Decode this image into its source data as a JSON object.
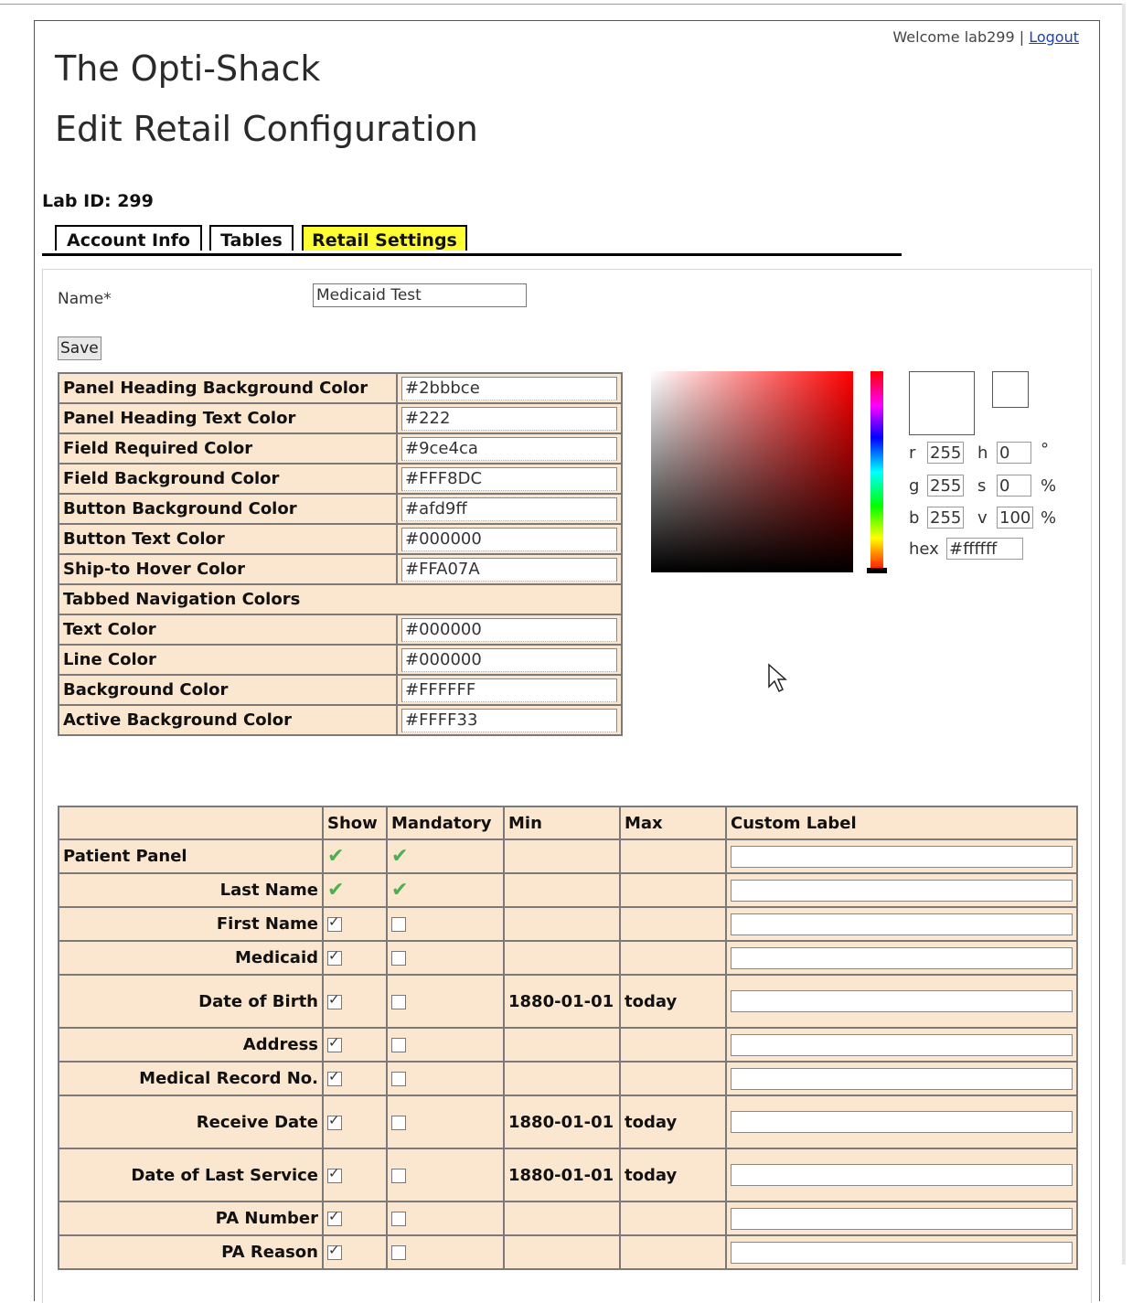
{
  "header": {
    "welcome_text": "Welcome lab299 |",
    "logout_label": "Logout",
    "app_title": "The Opti-Shack",
    "page_title": "Edit Retail Configuration",
    "lab_id": "Lab ID: 299"
  },
  "tabs": [
    {
      "label": "Account Info",
      "active": false
    },
    {
      "label": "Tables",
      "active": false
    },
    {
      "label": "Retail Settings",
      "active": true
    }
  ],
  "form": {
    "name_label": "Name*",
    "name_value": "Medicaid Test",
    "save_label": "Save"
  },
  "color_settings": {
    "rows": [
      {
        "label": "Panel Heading Background Color",
        "value": "#2bbbce"
      },
      {
        "label": "Panel Heading Text Color",
        "value": "#222"
      },
      {
        "label": "Field Required Color",
        "value": "#9ce4ca"
      },
      {
        "label": "Field Background Color",
        "value": "#FFF8DC"
      },
      {
        "label": "Button Background Color",
        "value": "#afd9ff"
      },
      {
        "label": "Button Text Color",
        "value": "#000000"
      },
      {
        "label": "Ship-to Hover Color",
        "value": "#FFA07A"
      }
    ],
    "section_heading": "Tabbed Navigation Colors",
    "nav_rows": [
      {
        "label": "Text Color",
        "value": "#000000"
      },
      {
        "label": "Line Color",
        "value": "#000000"
      },
      {
        "label": "Background Color",
        "value": "#FFFFFF"
      },
      {
        "label": "Active Background Color",
        "value": "#FFFF33"
      }
    ]
  },
  "color_picker": {
    "r_label": "r",
    "r": "255",
    "g_label": "g",
    "g": "255",
    "b_label": "b",
    "b": "255",
    "h_label": "h",
    "h": "0",
    "h_unit": "°",
    "s_label": "s",
    "s": "0",
    "s_unit": "%",
    "v_label": "v",
    "v": "100",
    "v_unit": "%",
    "hex_label": "hex",
    "hex": "#ffffff"
  },
  "fields_table": {
    "headers": [
      "",
      "Show",
      "Mandatory",
      "Min",
      "Max",
      "Custom Label"
    ],
    "rows": [
      {
        "label": "Patient Panel",
        "show": "tick",
        "mandatory": "tick",
        "min": "",
        "max": "",
        "section": true
      },
      {
        "label": "Last Name",
        "show": "tick",
        "mandatory": "tick",
        "min": "",
        "max": ""
      },
      {
        "label": "First Name",
        "show": "checked",
        "mandatory": "unchecked",
        "min": "",
        "max": ""
      },
      {
        "label": "Medicaid",
        "show": "checked",
        "mandatory": "unchecked",
        "min": "",
        "max": ""
      },
      {
        "label": "Date of Birth",
        "show": "checked",
        "mandatory": "unchecked",
        "min": "1880-01-01",
        "max": "today"
      },
      {
        "label": "Address",
        "show": "checked",
        "mandatory": "unchecked",
        "min": "",
        "max": ""
      },
      {
        "label": "Medical Record No.",
        "show": "checked",
        "mandatory": "unchecked",
        "min": "",
        "max": ""
      },
      {
        "label": "Receive Date",
        "show": "checked",
        "mandatory": "unchecked",
        "min": "1880-01-01",
        "max": "today"
      },
      {
        "label": "Date of Last Service",
        "show": "checked",
        "mandatory": "unchecked",
        "min": "1880-01-01",
        "max": "today"
      },
      {
        "label": "PA Number",
        "show": "checked",
        "mandatory": "unchecked",
        "min": "",
        "max": ""
      },
      {
        "label": "PA Reason",
        "show": "checked",
        "mandatory": "unchecked",
        "min": "",
        "max": ""
      }
    ]
  }
}
